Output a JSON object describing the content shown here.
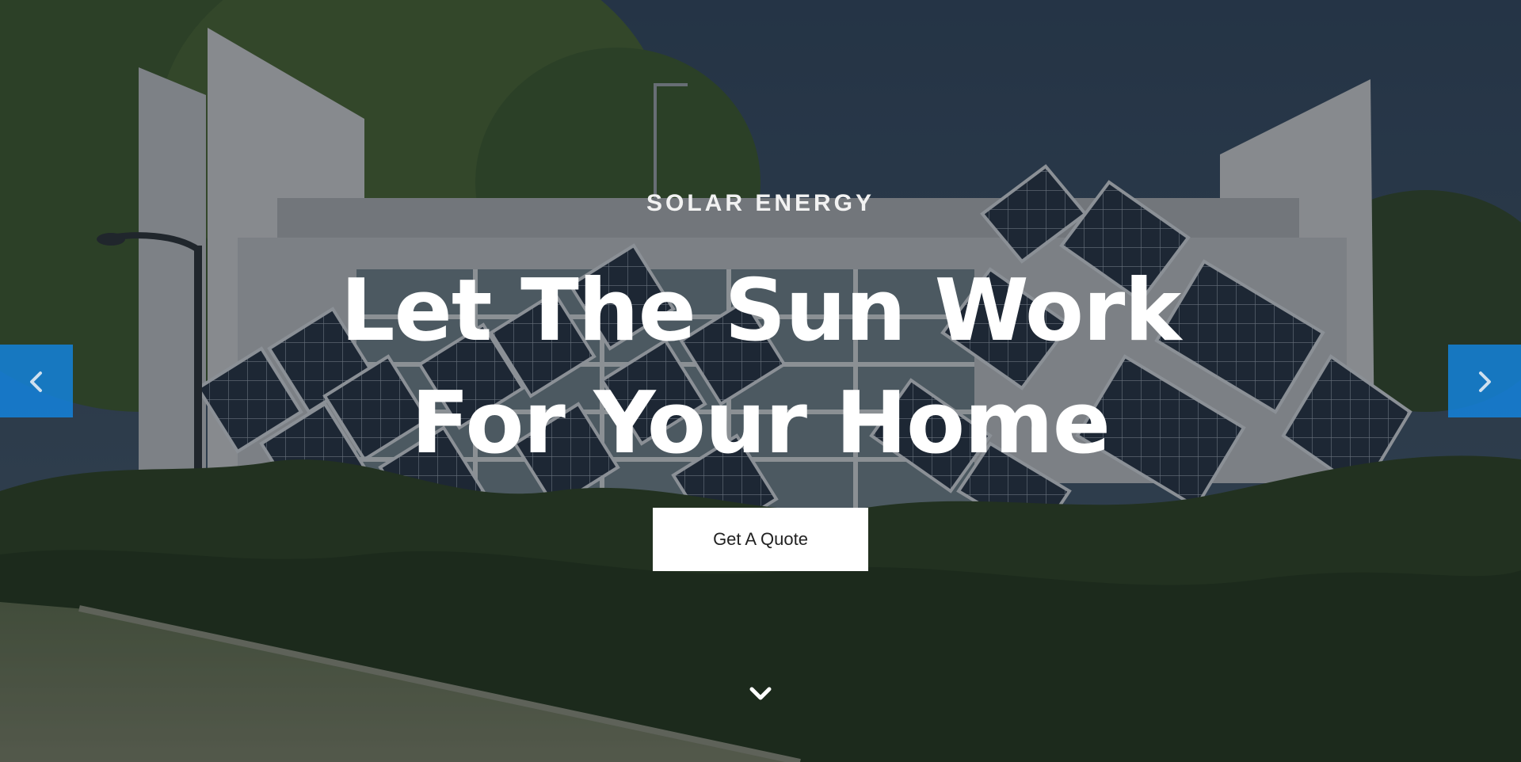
{
  "hero": {
    "eyebrow": "SOLAR ENERGY",
    "headline": "Let The Sun Work For Your Home",
    "cta_label": "Get A Quote"
  },
  "slider": {
    "prev_icon": "chevron-left-icon",
    "next_icon": "chevron-right-icon"
  },
  "scroll": {
    "icon": "chevron-down-icon"
  },
  "colors": {
    "accent": "#1e88e5",
    "headline": "#ffffff",
    "button_bg": "#ffffff",
    "button_text": "#222222"
  }
}
